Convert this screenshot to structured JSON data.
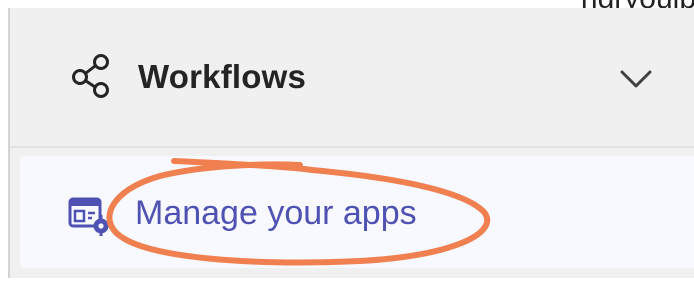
{
  "top_remnant_text": "ngryouip",
  "workflows": {
    "icon": "workflows-icon",
    "title": "Workflows",
    "expand_icon": "chevron-down-icon"
  },
  "manage_apps": {
    "icon": "manage-apps-icon",
    "label": "Manage your apps"
  },
  "colors": {
    "panel_bg": "#f0f0f0",
    "apps_row_bg": "#f8f9ff",
    "accent": "#4f52b2",
    "annotation": "#f08050"
  }
}
